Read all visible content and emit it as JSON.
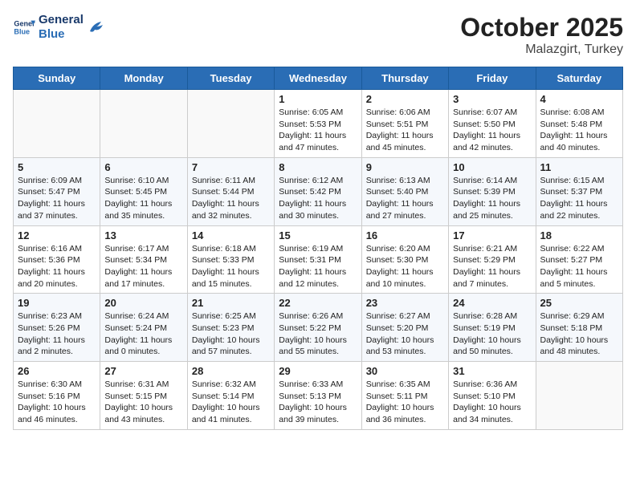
{
  "header": {
    "logo_line1": "General",
    "logo_line2": "Blue",
    "month": "October 2025",
    "location": "Malazgirt, Turkey"
  },
  "weekdays": [
    "Sunday",
    "Monday",
    "Tuesday",
    "Wednesday",
    "Thursday",
    "Friday",
    "Saturday"
  ],
  "weeks": [
    [
      {
        "day": "",
        "info": ""
      },
      {
        "day": "",
        "info": ""
      },
      {
        "day": "",
        "info": ""
      },
      {
        "day": "1",
        "info": "Sunrise: 6:05 AM\nSunset: 5:53 PM\nDaylight: 11 hours and 47 minutes."
      },
      {
        "day": "2",
        "info": "Sunrise: 6:06 AM\nSunset: 5:51 PM\nDaylight: 11 hours and 45 minutes."
      },
      {
        "day": "3",
        "info": "Sunrise: 6:07 AM\nSunset: 5:50 PM\nDaylight: 11 hours and 42 minutes."
      },
      {
        "day": "4",
        "info": "Sunrise: 6:08 AM\nSunset: 5:48 PM\nDaylight: 11 hours and 40 minutes."
      }
    ],
    [
      {
        "day": "5",
        "info": "Sunrise: 6:09 AM\nSunset: 5:47 PM\nDaylight: 11 hours and 37 minutes."
      },
      {
        "day": "6",
        "info": "Sunrise: 6:10 AM\nSunset: 5:45 PM\nDaylight: 11 hours and 35 minutes."
      },
      {
        "day": "7",
        "info": "Sunrise: 6:11 AM\nSunset: 5:44 PM\nDaylight: 11 hours and 32 minutes."
      },
      {
        "day": "8",
        "info": "Sunrise: 6:12 AM\nSunset: 5:42 PM\nDaylight: 11 hours and 30 minutes."
      },
      {
        "day": "9",
        "info": "Sunrise: 6:13 AM\nSunset: 5:40 PM\nDaylight: 11 hours and 27 minutes."
      },
      {
        "day": "10",
        "info": "Sunrise: 6:14 AM\nSunset: 5:39 PM\nDaylight: 11 hours and 25 minutes."
      },
      {
        "day": "11",
        "info": "Sunrise: 6:15 AM\nSunset: 5:37 PM\nDaylight: 11 hours and 22 minutes."
      }
    ],
    [
      {
        "day": "12",
        "info": "Sunrise: 6:16 AM\nSunset: 5:36 PM\nDaylight: 11 hours and 20 minutes."
      },
      {
        "day": "13",
        "info": "Sunrise: 6:17 AM\nSunset: 5:34 PM\nDaylight: 11 hours and 17 minutes."
      },
      {
        "day": "14",
        "info": "Sunrise: 6:18 AM\nSunset: 5:33 PM\nDaylight: 11 hours and 15 minutes."
      },
      {
        "day": "15",
        "info": "Sunrise: 6:19 AM\nSunset: 5:31 PM\nDaylight: 11 hours and 12 minutes."
      },
      {
        "day": "16",
        "info": "Sunrise: 6:20 AM\nSunset: 5:30 PM\nDaylight: 11 hours and 10 minutes."
      },
      {
        "day": "17",
        "info": "Sunrise: 6:21 AM\nSunset: 5:29 PM\nDaylight: 11 hours and 7 minutes."
      },
      {
        "day": "18",
        "info": "Sunrise: 6:22 AM\nSunset: 5:27 PM\nDaylight: 11 hours and 5 minutes."
      }
    ],
    [
      {
        "day": "19",
        "info": "Sunrise: 6:23 AM\nSunset: 5:26 PM\nDaylight: 11 hours and 2 minutes."
      },
      {
        "day": "20",
        "info": "Sunrise: 6:24 AM\nSunset: 5:24 PM\nDaylight: 11 hours and 0 minutes."
      },
      {
        "day": "21",
        "info": "Sunrise: 6:25 AM\nSunset: 5:23 PM\nDaylight: 10 hours and 57 minutes."
      },
      {
        "day": "22",
        "info": "Sunrise: 6:26 AM\nSunset: 5:22 PM\nDaylight: 10 hours and 55 minutes."
      },
      {
        "day": "23",
        "info": "Sunrise: 6:27 AM\nSunset: 5:20 PM\nDaylight: 10 hours and 53 minutes."
      },
      {
        "day": "24",
        "info": "Sunrise: 6:28 AM\nSunset: 5:19 PM\nDaylight: 10 hours and 50 minutes."
      },
      {
        "day": "25",
        "info": "Sunrise: 6:29 AM\nSunset: 5:18 PM\nDaylight: 10 hours and 48 minutes."
      }
    ],
    [
      {
        "day": "26",
        "info": "Sunrise: 6:30 AM\nSunset: 5:16 PM\nDaylight: 10 hours and 46 minutes."
      },
      {
        "day": "27",
        "info": "Sunrise: 6:31 AM\nSunset: 5:15 PM\nDaylight: 10 hours and 43 minutes."
      },
      {
        "day": "28",
        "info": "Sunrise: 6:32 AM\nSunset: 5:14 PM\nDaylight: 10 hours and 41 minutes."
      },
      {
        "day": "29",
        "info": "Sunrise: 6:33 AM\nSunset: 5:13 PM\nDaylight: 10 hours and 39 minutes."
      },
      {
        "day": "30",
        "info": "Sunrise: 6:35 AM\nSunset: 5:11 PM\nDaylight: 10 hours and 36 minutes."
      },
      {
        "day": "31",
        "info": "Sunrise: 6:36 AM\nSunset: 5:10 PM\nDaylight: 10 hours and 34 minutes."
      },
      {
        "day": "",
        "info": ""
      }
    ]
  ]
}
